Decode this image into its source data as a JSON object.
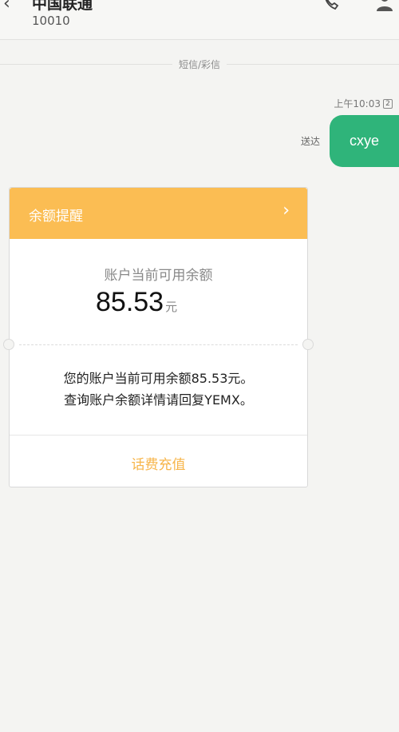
{
  "header": {
    "contact_name": "中国联通",
    "contact_number": "10010"
  },
  "thread": {
    "type_label": "短信/彩信"
  },
  "sent_message": {
    "time": "上午10:03",
    "sim": "2",
    "status": "送达",
    "text": "cxye"
  },
  "card": {
    "title": "余额提醒",
    "balance_label": "账户当前可用余额",
    "balance_amount": "85.53",
    "balance_unit": "元",
    "body_lines": [
      "您的账户当前可用余额85.53元。",
      "查询账户余额详情请回复YEMX。"
    ],
    "action_label": "话费充值"
  },
  "colors": {
    "bubble": "#2fb47a",
    "card_header": "#fbbd53",
    "action": "#f7b54a"
  }
}
